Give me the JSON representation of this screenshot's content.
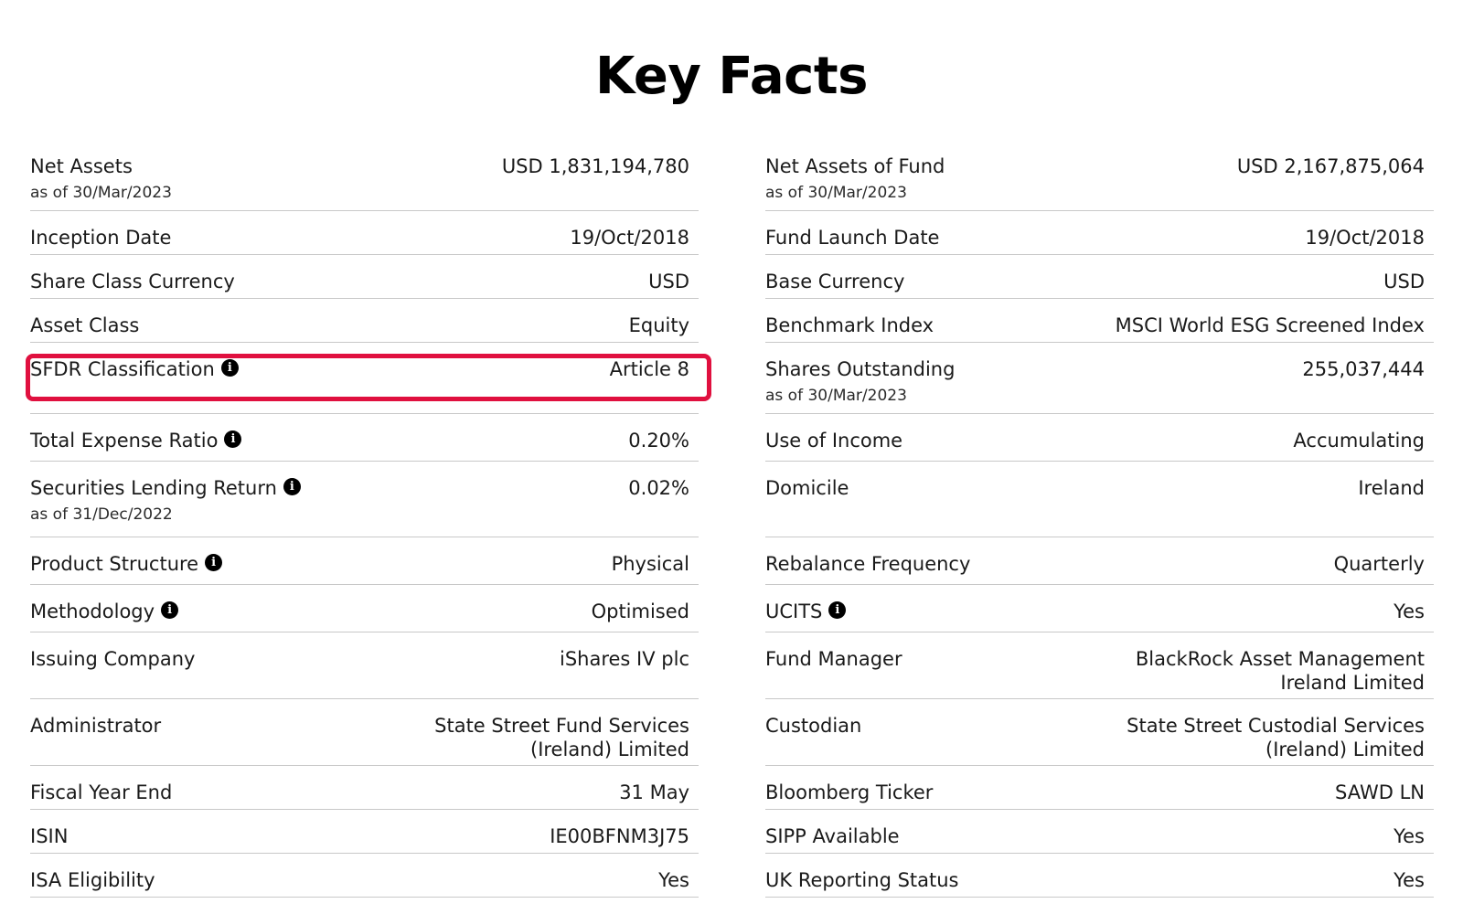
{
  "page": {
    "title": "Key Facts"
  },
  "left_rows": [
    {
      "label": "Net Assets",
      "sub": "as of 30/Mar/2023",
      "value": "USD 1,831,194,780"
    },
    {
      "label": "Inception Date",
      "value": "19/Oct/2018"
    },
    {
      "label": "Share Class Currency",
      "value": "USD"
    },
    {
      "label": "Asset Class",
      "value": "Equity"
    },
    {
      "label": "SFDR Classification",
      "info": true,
      "value": "Article 8",
      "highlighted": true
    },
    {
      "label": "Total Expense Ratio",
      "info": true,
      "value": "0.20%"
    },
    {
      "label": "Securities Lending Return",
      "info": true,
      "sub": "as of 31/Dec/2022",
      "value": "0.02%"
    },
    {
      "label": "Product Structure",
      "info": true,
      "value": "Physical"
    },
    {
      "label": "Methodology",
      "info": true,
      "value": "Optimised"
    },
    {
      "label": "Issuing Company",
      "value": "iShares IV plc"
    },
    {
      "label": "Administrator",
      "value": "State Street Fund Services\n(Ireland) Limited"
    },
    {
      "label": "Fiscal Year End",
      "value": "31 May"
    },
    {
      "label": "ISIN",
      "value": "IE00BFNM3J75"
    },
    {
      "label": "ISA Eligibility",
      "value": "Yes"
    }
  ],
  "right_rows": [
    {
      "label": "Net Assets of Fund",
      "sub": "as of 30/Mar/2023",
      "value": "USD 2,167,875,064"
    },
    {
      "label": "Fund Launch Date",
      "value": "19/Oct/2018"
    },
    {
      "label": "Base Currency",
      "value": "USD"
    },
    {
      "label": "Benchmark Index",
      "value": "MSCI World ESG Screened Index"
    },
    {
      "label": "Shares Outstanding",
      "sub": "as of 30/Mar/2023",
      "value": "255,037,444"
    },
    {
      "label": "Use of Income",
      "value": "Accumulating"
    },
    {
      "label": "Domicile",
      "value": "Ireland"
    },
    {
      "label": "Rebalance Frequency",
      "value": "Quarterly"
    },
    {
      "label": "UCITS",
      "info": true,
      "value": "Yes"
    },
    {
      "label": "Fund Manager",
      "value": "BlackRock Asset Management\nIreland Limited"
    },
    {
      "label": "Custodian",
      "value": "State Street Custodial Services\n(Ireland) Limited"
    },
    {
      "label": "Bloomberg Ticker",
      "value": "SAWD LN"
    },
    {
      "label": "SIPP Available",
      "value": "Yes"
    },
    {
      "label": "UK Reporting Status",
      "value": "Yes"
    }
  ],
  "icons": {
    "info": "info-icon",
    "info_glyph": "i"
  },
  "colors": {
    "highlight_border": "#e0103f",
    "divider": "#c8c8c8",
    "text": "#1a1a1a"
  }
}
